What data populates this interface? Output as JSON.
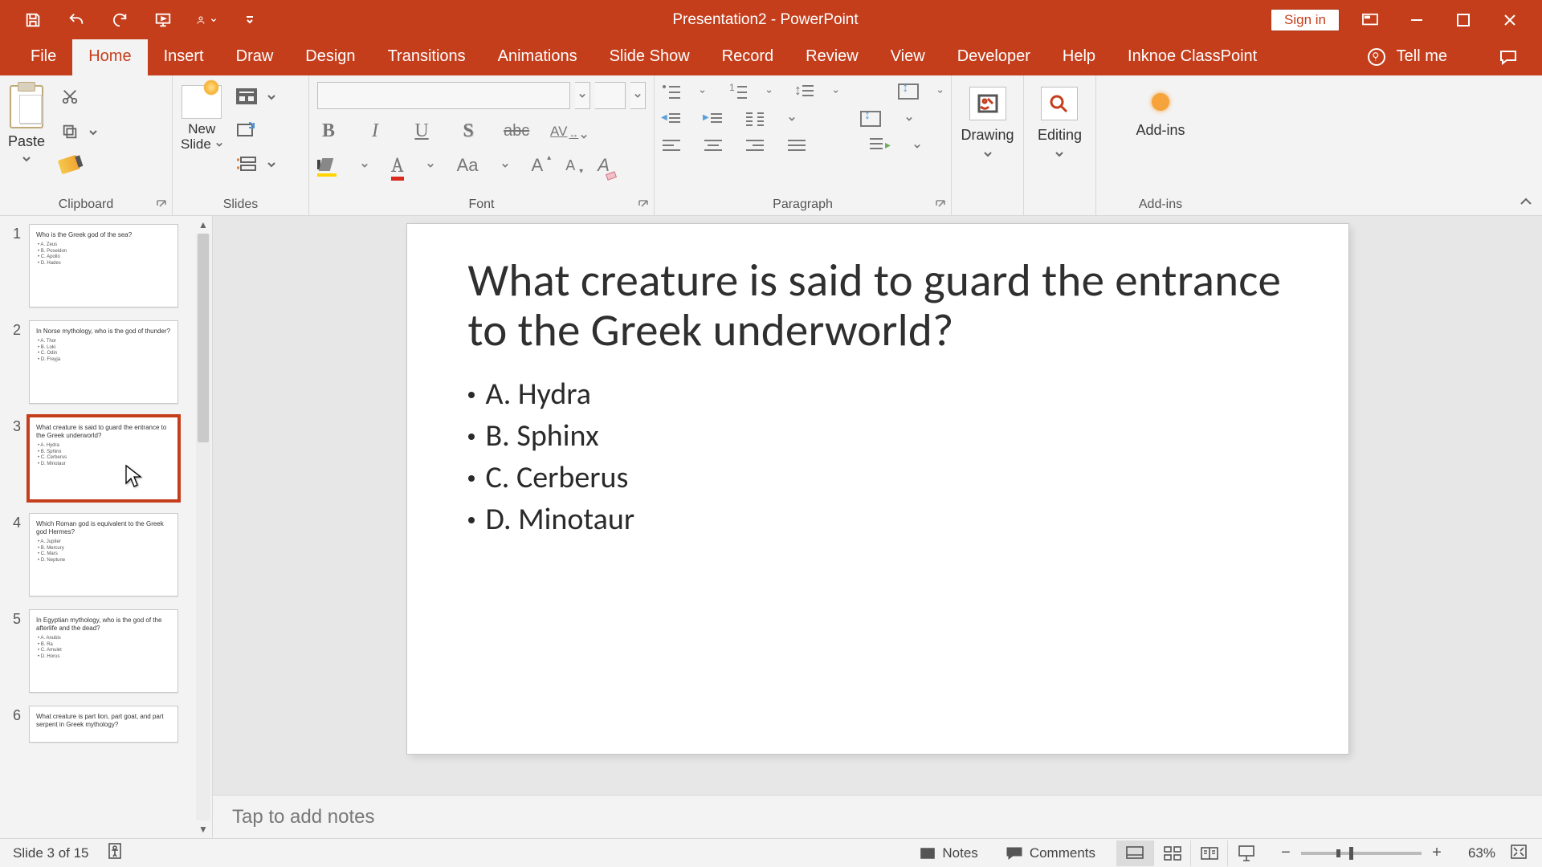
{
  "title": "Presentation2  -  PowerPoint",
  "quick_access": {
    "signin": "Sign in"
  },
  "tabs": [
    "File",
    "Home",
    "Insert",
    "Draw",
    "Design",
    "Transitions",
    "Animations",
    "Slide Show",
    "Record",
    "Review",
    "View",
    "Developer",
    "Help",
    "Inknoe ClassPoint"
  ],
  "active_tab": "Home",
  "tellme": "Tell me",
  "ribbon": {
    "clipboard": {
      "paste": "Paste",
      "group": "Clipboard"
    },
    "slides": {
      "new_slide_line1": "New",
      "new_slide_line2": "Slide",
      "group": "Slides"
    },
    "font": {
      "group": "Font",
      "bold": "B",
      "italic": "I",
      "underline": "U",
      "shadow": "S",
      "strike": "abc",
      "spacing": "AV",
      "hl": "ab",
      "fontcolor": "A",
      "changecase": "Aa",
      "grow": "A",
      "shrink": "A",
      "clear": "A"
    },
    "paragraph": {
      "group": "Paragraph"
    },
    "drawing": {
      "label": "Drawing"
    },
    "editing": {
      "label": "Editing"
    },
    "addins": {
      "label": "Add-ins",
      "group": "Add-ins"
    }
  },
  "thumbnails": [
    {
      "n": "1",
      "title": "Who is the Greek god of the sea?",
      "opts": [
        "• A. Zeus",
        "• B. Poseidon",
        "• C. Apollo",
        "• D. Hades"
      ]
    },
    {
      "n": "2",
      "title": "In Norse mythology, who is the god of thunder?",
      "opts": [
        "• A. Thor",
        "• B. Loki",
        "• C. Odin",
        "• D. Freyja"
      ]
    },
    {
      "n": "3",
      "title": "What creature is said to guard the entrance to the Greek underworld?",
      "opts": [
        "• A. Hydra",
        "• B. Sphinx",
        "• C. Cerberus",
        "• D. Minotaur"
      ]
    },
    {
      "n": "4",
      "title": "Which Roman god is equivalent to the Greek god Hermes?",
      "opts": [
        "• A. Jupiter",
        "• B. Mercury",
        "• C. Mars",
        "• D. Neptune"
      ]
    },
    {
      "n": "5",
      "title": "In Egyptian mythology, who is the god of the afterlife and the dead?",
      "opts": [
        "• A. Anubis",
        "• B. Ra",
        "• C. Amulet",
        "• D. Horus"
      ]
    },
    {
      "n": "6",
      "title": "What creature is part lion, part goat, and part serpent in Greek mythology?",
      "opts": []
    }
  ],
  "selected_thumb_index": 2,
  "slide": {
    "title": "What creature is said to guard the entrance to the Greek underworld?",
    "options": [
      "A. Hydra",
      "B. Sphinx",
      "C. Cerberus",
      "D. Minotaur"
    ]
  },
  "notes_placeholder": "Tap to add notes",
  "status": {
    "slide_counter": "Slide 3 of 15",
    "notes": "Notes",
    "comments": "Comments",
    "zoom": "63%"
  }
}
